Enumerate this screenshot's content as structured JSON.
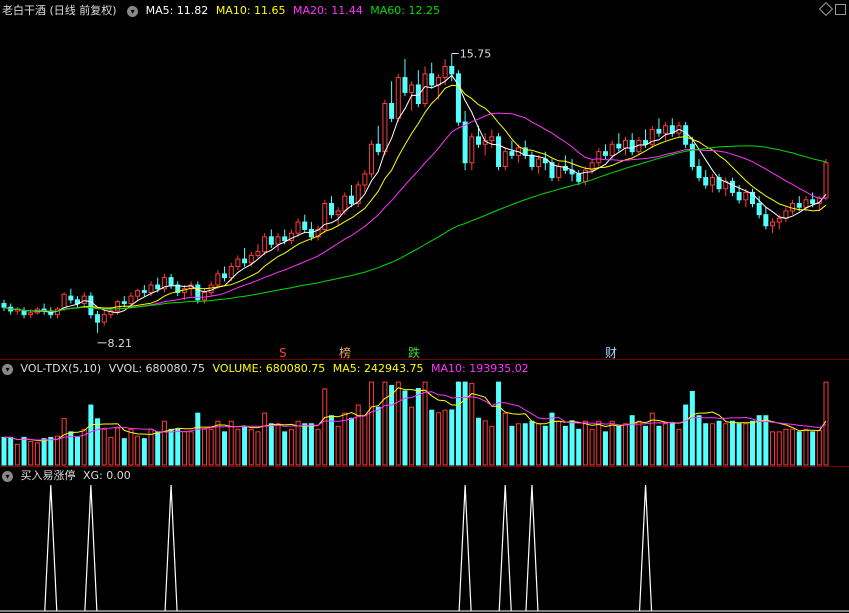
{
  "header_main": {
    "stock_name": "老白干酒",
    "period": "(日线 前复权)",
    "ma5": "MA5: 11.82",
    "ma10": "MA10: 11.65",
    "ma20": "MA20: 11.44",
    "ma60": "MA60: 12.25"
  },
  "header_vol": {
    "name": "VOL-TDX(5,10)",
    "vvol": "VVOL: 680080.75",
    "volume": "VOLUME: 680080.75",
    "ma5": "MA5: 242943.75",
    "ma10": "MA10: 193935.02"
  },
  "header_ind": {
    "name": "买入易涨停",
    "xg": "XG: 0.00"
  },
  "annotations": {
    "high": "15.75",
    "low": "8.21",
    "marker_s": "S",
    "marker_bang": "榜",
    "marker_die": "跌",
    "marker_cai": "财"
  },
  "colors": {
    "up": "#ff3b3b",
    "down": "#54ffff",
    "ma5": "#ffffff",
    "ma10": "#ffff00",
    "ma20": "#ff33ff",
    "ma60": "#00dd00"
  },
  "chart_data": {
    "type": "candlestick",
    "price_range": [
      7.8,
      16.6
    ],
    "candles": [
      [
        9.0,
        9.1,
        8.8,
        8.9
      ],
      [
        8.9,
        9.0,
        8.7,
        8.8
      ],
      [
        8.8,
        8.9,
        8.7,
        8.85
      ],
      [
        8.8,
        8.9,
        8.6,
        8.7
      ],
      [
        8.7,
        8.85,
        8.6,
        8.75
      ],
      [
        8.75,
        8.9,
        8.7,
        8.85
      ],
      [
        8.85,
        9.0,
        8.7,
        8.8
      ],
      [
        8.8,
        8.9,
        8.6,
        8.7
      ],
      [
        8.7,
        8.9,
        8.6,
        8.85
      ],
      [
        8.85,
        9.3,
        8.8,
        9.25
      ],
      [
        9.2,
        9.4,
        9.0,
        9.1
      ],
      [
        9.1,
        9.2,
        8.9,
        9.0
      ],
      [
        9.0,
        9.3,
        8.9,
        9.2
      ],
      [
        9.2,
        9.3,
        8.6,
        8.7
      ],
      [
        8.7,
        8.8,
        8.21,
        8.5
      ],
      [
        8.5,
        8.8,
        8.4,
        8.7
      ],
      [
        8.7,
        8.9,
        8.6,
        8.8
      ],
      [
        8.8,
        9.1,
        8.7,
        9.05
      ],
      [
        9.05,
        9.2,
        8.9,
        9.0
      ],
      [
        9.0,
        9.3,
        8.9,
        9.2
      ],
      [
        9.2,
        9.4,
        9.1,
        9.35
      ],
      [
        9.35,
        9.5,
        9.2,
        9.3
      ],
      [
        9.3,
        9.6,
        9.2,
        9.5
      ],
      [
        9.5,
        9.7,
        9.3,
        9.4
      ],
      [
        9.4,
        9.8,
        9.3,
        9.7
      ],
      [
        9.7,
        9.8,
        9.4,
        9.5
      ],
      [
        9.5,
        9.6,
        9.2,
        9.3
      ],
      [
        9.3,
        9.5,
        9.1,
        9.4
      ],
      [
        9.4,
        9.6,
        9.2,
        9.5
      ],
      [
        9.5,
        9.6,
        9.0,
        9.1
      ],
      [
        9.1,
        9.4,
        9.0,
        9.3
      ],
      [
        9.3,
        9.6,
        9.2,
        9.5
      ],
      [
        9.5,
        9.9,
        9.4,
        9.8
      ],
      [
        9.8,
        10.0,
        9.6,
        9.7
      ],
      [
        9.7,
        10.1,
        9.6,
        10.0
      ],
      [
        10.0,
        10.3,
        9.9,
        10.2
      ],
      [
        10.2,
        10.5,
        10.0,
        10.1
      ],
      [
        10.1,
        10.4,
        10.0,
        10.3
      ],
      [
        10.3,
        10.6,
        10.2,
        10.4
      ],
      [
        10.4,
        10.9,
        10.3,
        10.8
      ],
      [
        10.8,
        11.0,
        10.5,
        10.6
      ],
      [
        10.6,
        10.9,
        10.4,
        10.8
      ],
      [
        10.8,
        11.0,
        10.6,
        10.7
      ],
      [
        10.7,
        11.0,
        10.6,
        10.9
      ],
      [
        10.9,
        11.3,
        10.8,
        11.2
      ],
      [
        11.2,
        11.4,
        10.9,
        11.0
      ],
      [
        11.0,
        11.2,
        10.7,
        10.8
      ],
      [
        10.8,
        11.1,
        10.7,
        11.0
      ],
      [
        11.0,
        11.8,
        10.9,
        11.7
      ],
      [
        11.7,
        11.9,
        11.3,
        11.4
      ],
      [
        11.4,
        11.6,
        11.1,
        11.5
      ],
      [
        11.5,
        12.0,
        11.4,
        11.9
      ],
      [
        11.9,
        12.2,
        11.6,
        11.7
      ],
      [
        11.7,
        12.3,
        11.6,
        12.2
      ],
      [
        12.2,
        12.6,
        12.0,
        12.5
      ],
      [
        12.5,
        13.4,
        12.4,
        13.3
      ],
      [
        13.3,
        13.8,
        13.0,
        13.1
      ],
      [
        13.1,
        14.5,
        13.0,
        14.4
      ],
      [
        14.4,
        15.0,
        13.9,
        14.0
      ],
      [
        14.0,
        15.2,
        13.9,
        15.1
      ],
      [
        15.1,
        15.6,
        14.6,
        14.7
      ],
      [
        14.7,
        15.0,
        14.2,
        14.9
      ],
      [
        14.9,
        15.3,
        14.3,
        14.4
      ],
      [
        14.4,
        15.4,
        14.3,
        15.2
      ],
      [
        15.2,
        15.5,
        14.8,
        14.9
      ],
      [
        14.9,
        15.2,
        14.5,
        15.1
      ],
      [
        15.1,
        15.6,
        14.9,
        15.4
      ],
      [
        15.4,
        15.75,
        15.0,
        15.2
      ],
      [
        15.2,
        15.3,
        13.8,
        13.9
      ],
      [
        13.9,
        14.2,
        12.6,
        12.8
      ],
      [
        12.8,
        13.6,
        12.6,
        13.5
      ],
      [
        13.5,
        13.8,
        13.2,
        13.3
      ],
      [
        13.3,
        13.6,
        13.0,
        13.4
      ],
      [
        13.4,
        13.7,
        13.2,
        13.5
      ],
      [
        13.5,
        13.6,
        12.6,
        12.7
      ],
      [
        12.7,
        13.2,
        12.6,
        13.1
      ],
      [
        13.1,
        13.4,
        12.9,
        13.0
      ],
      [
        13.0,
        13.3,
        12.8,
        13.2
      ],
      [
        13.2,
        13.4,
        12.9,
        13.0
      ],
      [
        13.0,
        13.1,
        12.6,
        12.7
      ],
      [
        12.7,
        13.0,
        12.5,
        12.9
      ],
      [
        12.9,
        13.1,
        12.6,
        12.8
      ],
      [
        12.8,
        12.9,
        12.3,
        12.4
      ],
      [
        12.4,
        12.8,
        12.3,
        12.7
      ],
      [
        12.7,
        13.0,
        12.5,
        12.6
      ],
      [
        12.6,
        12.9,
        12.3,
        12.5
      ],
      [
        12.5,
        12.6,
        12.2,
        12.3
      ],
      [
        12.3,
        12.7,
        12.2,
        12.6
      ],
      [
        12.6,
        12.9,
        12.5,
        12.8
      ],
      [
        12.8,
        13.2,
        12.7,
        13.1
      ],
      [
        13.1,
        13.3,
        12.9,
        13.0
      ],
      [
        13.0,
        13.4,
        12.9,
        13.3
      ],
      [
        13.3,
        13.6,
        13.1,
        13.2
      ],
      [
        13.2,
        13.5,
        13.0,
        13.4
      ],
      [
        13.4,
        13.6,
        13.0,
        13.1
      ],
      [
        13.1,
        13.5,
        13.0,
        13.4
      ],
      [
        13.4,
        13.7,
        13.2,
        13.3
      ],
      [
        13.3,
        13.8,
        13.2,
        13.7
      ],
      [
        13.7,
        14.0,
        13.5,
        13.6
      ],
      [
        13.6,
        13.9,
        13.4,
        13.8
      ],
      [
        13.8,
        14.0,
        13.5,
        13.6
      ],
      [
        13.6,
        13.9,
        13.5,
        13.8
      ],
      [
        13.8,
        13.9,
        13.2,
        13.3
      ],
      [
        13.3,
        13.5,
        12.6,
        12.7
      ],
      [
        12.7,
        12.9,
        12.3,
        12.4
      ],
      [
        12.4,
        12.6,
        12.1,
        12.2
      ],
      [
        12.2,
        12.5,
        12.0,
        12.4
      ],
      [
        12.4,
        12.5,
        12.0,
        12.1
      ],
      [
        12.1,
        12.4,
        11.9,
        12.3
      ],
      [
        12.3,
        12.4,
        11.9,
        12.0
      ],
      [
        12.0,
        12.2,
        11.7,
        11.8
      ],
      [
        11.8,
        12.1,
        11.6,
        12.0
      ],
      [
        12.0,
        12.1,
        11.6,
        11.7
      ],
      [
        11.7,
        11.9,
        11.3,
        11.4
      ],
      [
        11.4,
        11.6,
        11.0,
        11.1
      ],
      [
        11.1,
        11.3,
        10.9,
        11.2
      ],
      [
        11.2,
        11.4,
        11.0,
        11.3
      ],
      [
        11.3,
        11.6,
        11.2,
        11.5
      ],
      [
        11.5,
        11.8,
        11.4,
        11.7
      ],
      [
        11.7,
        11.9,
        11.5,
        11.6
      ],
      [
        11.6,
        11.9,
        11.5,
        11.8
      ],
      [
        11.8,
        12.0,
        11.6,
        11.7
      ],
      [
        11.7,
        11.9,
        11.5,
        11.85
      ],
      [
        11.85,
        12.9,
        11.8,
        12.8
      ]
    ],
    "volume_range": [
      0,
      400000
    ],
    "xg_signals_at": [
      7,
      13,
      25,
      69,
      75,
      79,
      96
    ]
  }
}
